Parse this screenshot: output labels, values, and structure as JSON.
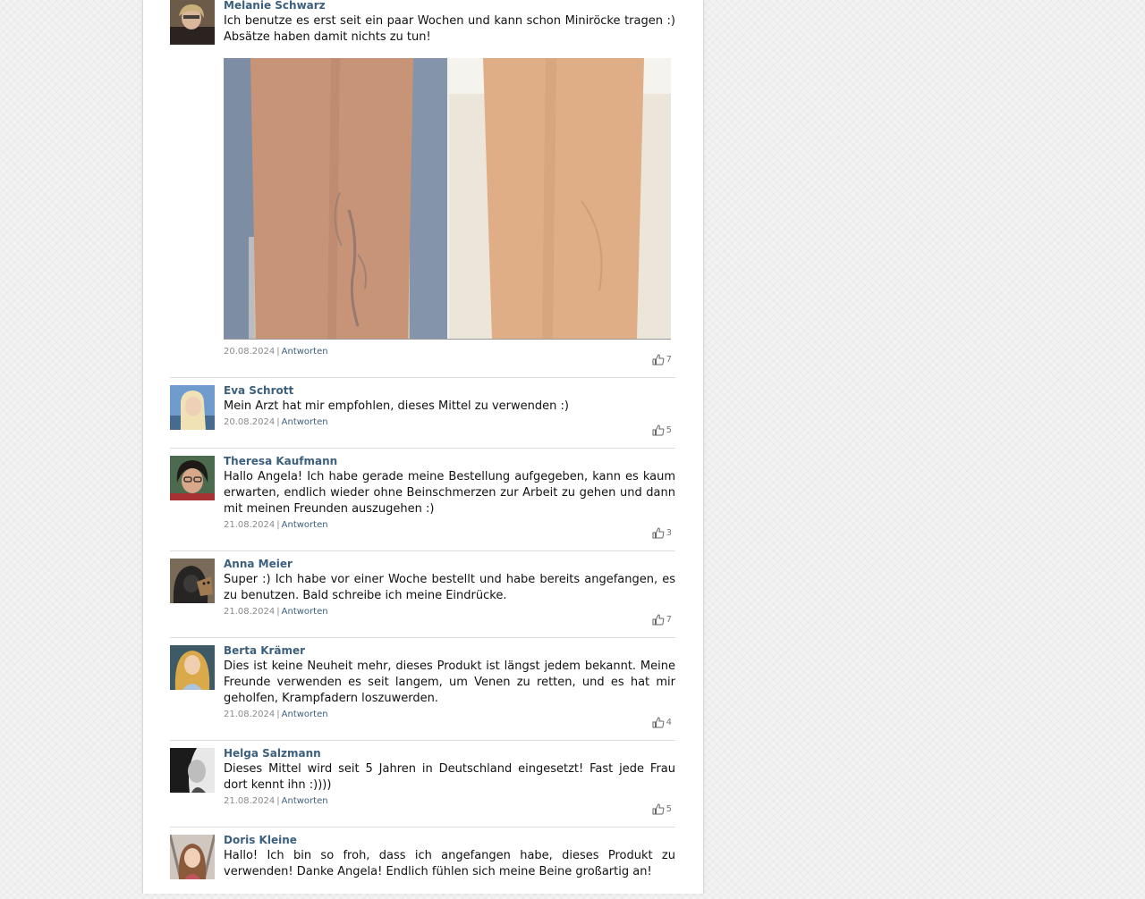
{
  "comments": [
    {
      "name": "Melanie Schwarz",
      "text": "Ich benutze es erst seit ein paar Wochen und kann schon Miniröcke tragen :) Absätze haben damit nichts zu tun!",
      "date": "20.08.2024",
      "reply": "Antworten",
      "likes": "7",
      "has_photo": true,
      "avatar": "avatar-melanie"
    },
    {
      "name": "Eva Schrott",
      "text": "Mein Arzt hat mir empfohlen, dieses Mittel zu verwenden :)",
      "date": "20.08.2024",
      "reply": "Antworten",
      "likes": "5",
      "avatar": "avatar-eva"
    },
    {
      "name": "Theresa Kaufmann",
      "text": "Hallo Angela! Ich habe gerade meine Bestellung aufgegeben, kann es kaum erwarten, endlich wieder ohne Beinschmerzen zur Arbeit zu gehen und dann mit meinen Freunden auszugehen :)",
      "date": "21.08.2024",
      "reply": "Antworten",
      "likes": "3",
      "avatar": "avatar-theresa"
    },
    {
      "name": "Anna Meier",
      "text": "Super :) Ich habe vor einer Woche bestellt und habe bereits angefangen, es zu benutzen. Bald schreibe ich meine Eindrücke.",
      "date": "21.08.2024",
      "reply": "Antworten",
      "likes": "7",
      "avatar": "avatar-anna"
    },
    {
      "name": "Berta Krämer",
      "text": "Dies ist keine Neuheit mehr, dieses Produkt ist längst jedem bekannt. Meine Freunde verwenden es seit langem, um Venen zu retten, und es hat mir geholfen, Krampfadern loszuwerden.",
      "date": "21.08.2024",
      "reply": "Antworten",
      "likes": "4",
      "avatar": "avatar-berta"
    },
    {
      "name": "Helga Salzmann",
      "text": "Dieses Mittel wird seit 5 Jahren in Deutschland eingesetzt! Fast jede Frau dort kennt ihn :))))",
      "date": "21.08.2024",
      "reply": "Antworten",
      "likes": "5",
      "avatar": "avatar-helga"
    },
    {
      "name": "Doris Kleine",
      "text": "Hallo! Ich bin so froh, dass ich angefangen habe, dieses Produkt zu verwenden! Danke Angela! Endlich fühlen sich meine Beine großartig an!",
      "date": "",
      "reply": "",
      "likes": "",
      "avatar": "avatar-doris"
    }
  ],
  "colors": {
    "name_link": "#3b5f7d",
    "meta_text": "#8a8a8a",
    "divider": "#dcdcdc",
    "page_bg": "#f3f3f3"
  },
  "icons": {
    "like": "thumbs-up-icon"
  }
}
